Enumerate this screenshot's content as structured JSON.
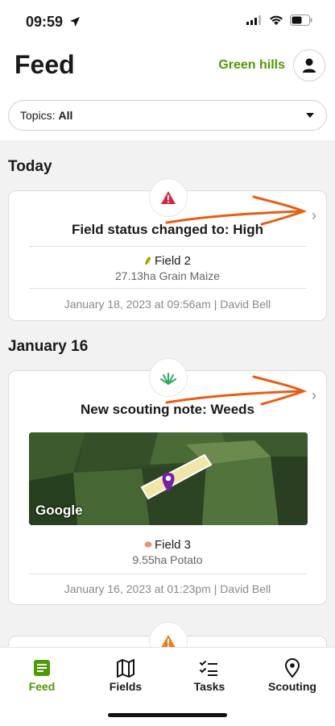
{
  "status": {
    "time": "09:59"
  },
  "header": {
    "title": "Feed",
    "farm_name": "Green hills",
    "topics_label": "Topics:",
    "topics_value": "All"
  },
  "sections": {
    "today": "Today",
    "jan16": "January 16"
  },
  "cards": [
    {
      "icon": "warning-icon",
      "title": "Field status changed to: High",
      "field_name": "Field 2",
      "field_meta": "27.13ha  Grain Maize",
      "footer": "January 18, 2023 at 09:56am  |  David Bell"
    },
    {
      "icon": "weeds-icon",
      "title": "New scouting note: Weeds",
      "map_brand": "Google",
      "field_name": "Field 3",
      "field_meta": "9.55ha  Potato",
      "footer": "January 16, 2023 at 01:23pm  |  David Bell"
    }
  ],
  "nav": {
    "feed": "Feed",
    "fields": "Fields",
    "tasks": "Tasks",
    "scouting": "Scouting"
  },
  "colors": {
    "accent": "#4e9a06",
    "warning_red": "#d9253a",
    "warning_orange": "#f07b1b",
    "annotation_arrow": "#e85d12"
  }
}
